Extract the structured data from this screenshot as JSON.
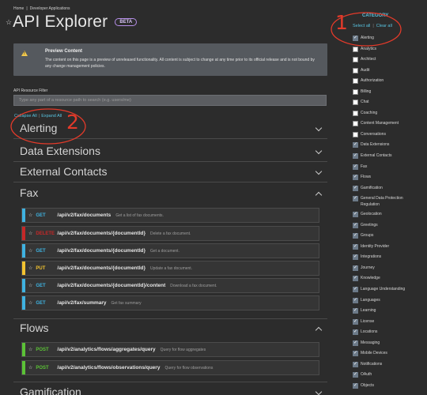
{
  "breadcrumb": {
    "home": "Home",
    "sep": "|",
    "current": "Developer Applications"
  },
  "page": {
    "title": "API Explorer",
    "badge": "BETA",
    "star": "☆"
  },
  "banner": {
    "title": "Preview Content",
    "text": "The content on this page is a preview of unreleased functionality. All content is subject to change at any time prior to its official release and is not bound by any change management policies."
  },
  "filter": {
    "label": "API Resource Filter",
    "placeholder": "Type any part of a resource path to search (e.g. users/me)"
  },
  "collapse": {
    "collapse_all": "Collapse All",
    "sep": "|",
    "expand_all": "Expand All"
  },
  "sections": [
    {
      "title": "Alerting",
      "expanded": false
    },
    {
      "title": "Data Extensions",
      "expanded": false
    },
    {
      "title": "External Contacts",
      "expanded": false
    },
    {
      "title": "Fax",
      "expanded": true
    },
    {
      "title": "Flows",
      "expanded": true
    },
    {
      "title": "Gamification",
      "expanded": false
    }
  ],
  "fax_ops": [
    {
      "star": "☆",
      "method": "GET",
      "path": "/api/v2/fax/documents",
      "desc": "Get a list of fax documents."
    },
    {
      "star": "☆",
      "method": "DELETE",
      "path": "/api/v2/fax/documents/{documentId}",
      "desc": "Delete a fax document."
    },
    {
      "star": "☆",
      "method": "GET",
      "path": "/api/v2/fax/documents/{documentId}",
      "desc": "Get a document."
    },
    {
      "star": "☆",
      "method": "PUT",
      "path": "/api/v2/fax/documents/{documentId}",
      "desc": "Update a fax document."
    },
    {
      "star": "☆",
      "method": "GET",
      "path": "/api/v2/fax/documents/{documentId}/content",
      "desc": "Download a fax document."
    },
    {
      "star": "☆",
      "method": "GET",
      "path": "/api/v2/fax/summary",
      "desc": "Get fax summary"
    }
  ],
  "flows_ops": [
    {
      "star": "☆",
      "method": "POST",
      "path": "/api/v2/analytics/flows/aggregates/query",
      "desc": "Query for flow aggregates"
    },
    {
      "star": "☆",
      "method": "POST",
      "path": "/api/v2/analytics/flows/observations/query",
      "desc": "Query for flow observations"
    }
  ],
  "method_colors": {
    "GET": "#3fb2e0",
    "DELETE": "#c62828",
    "PUT": "#f2c230",
    "POST": "#5bc236"
  },
  "category": {
    "title": "CATEGORY",
    "select_all": "Select all",
    "sep": "|",
    "clear_all": "Clear all",
    "items": [
      {
        "label": "Alerting",
        "checked": true
      },
      {
        "label": "Analytics",
        "checked": false
      },
      {
        "label": "Architect",
        "checked": false
      },
      {
        "label": "Audit",
        "checked": false
      },
      {
        "label": "Authorization",
        "checked": false
      },
      {
        "label": "Billing",
        "checked": false
      },
      {
        "label": "Chat",
        "checked": false
      },
      {
        "label": "Coaching",
        "checked": false
      },
      {
        "label": "Content Management",
        "checked": false
      },
      {
        "label": "Conversations",
        "checked": false
      },
      {
        "label": "Data Extensions",
        "checked": true
      },
      {
        "label": "External Contacts",
        "checked": true
      },
      {
        "label": "Fax",
        "checked": true
      },
      {
        "label": "Flows",
        "checked": true
      },
      {
        "label": "Gamification",
        "checked": true
      },
      {
        "label": "General Data Protection Regulation",
        "checked": true
      },
      {
        "label": "Geolocation",
        "checked": true
      },
      {
        "label": "Greetings",
        "checked": true
      },
      {
        "label": "Groups",
        "checked": true
      },
      {
        "label": "Identity Provider",
        "checked": true
      },
      {
        "label": "Integrations",
        "checked": true
      },
      {
        "label": "Journey",
        "checked": true
      },
      {
        "label": "Knowledge",
        "checked": true
      },
      {
        "label": "Language Understanding",
        "checked": true
      },
      {
        "label": "Languages",
        "checked": true
      },
      {
        "label": "Learning",
        "checked": true
      },
      {
        "label": "License",
        "checked": true
      },
      {
        "label": "Locations",
        "checked": true
      },
      {
        "label": "Messaging",
        "checked": true
      },
      {
        "label": "Mobile Devices",
        "checked": true
      },
      {
        "label": "Notifications",
        "checked": true
      },
      {
        "label": "OAuth",
        "checked": true
      },
      {
        "label": "Objects",
        "checked": true
      }
    ]
  },
  "annotations": {
    "one": "1",
    "two": "2",
    "color": "#e33a2a"
  }
}
